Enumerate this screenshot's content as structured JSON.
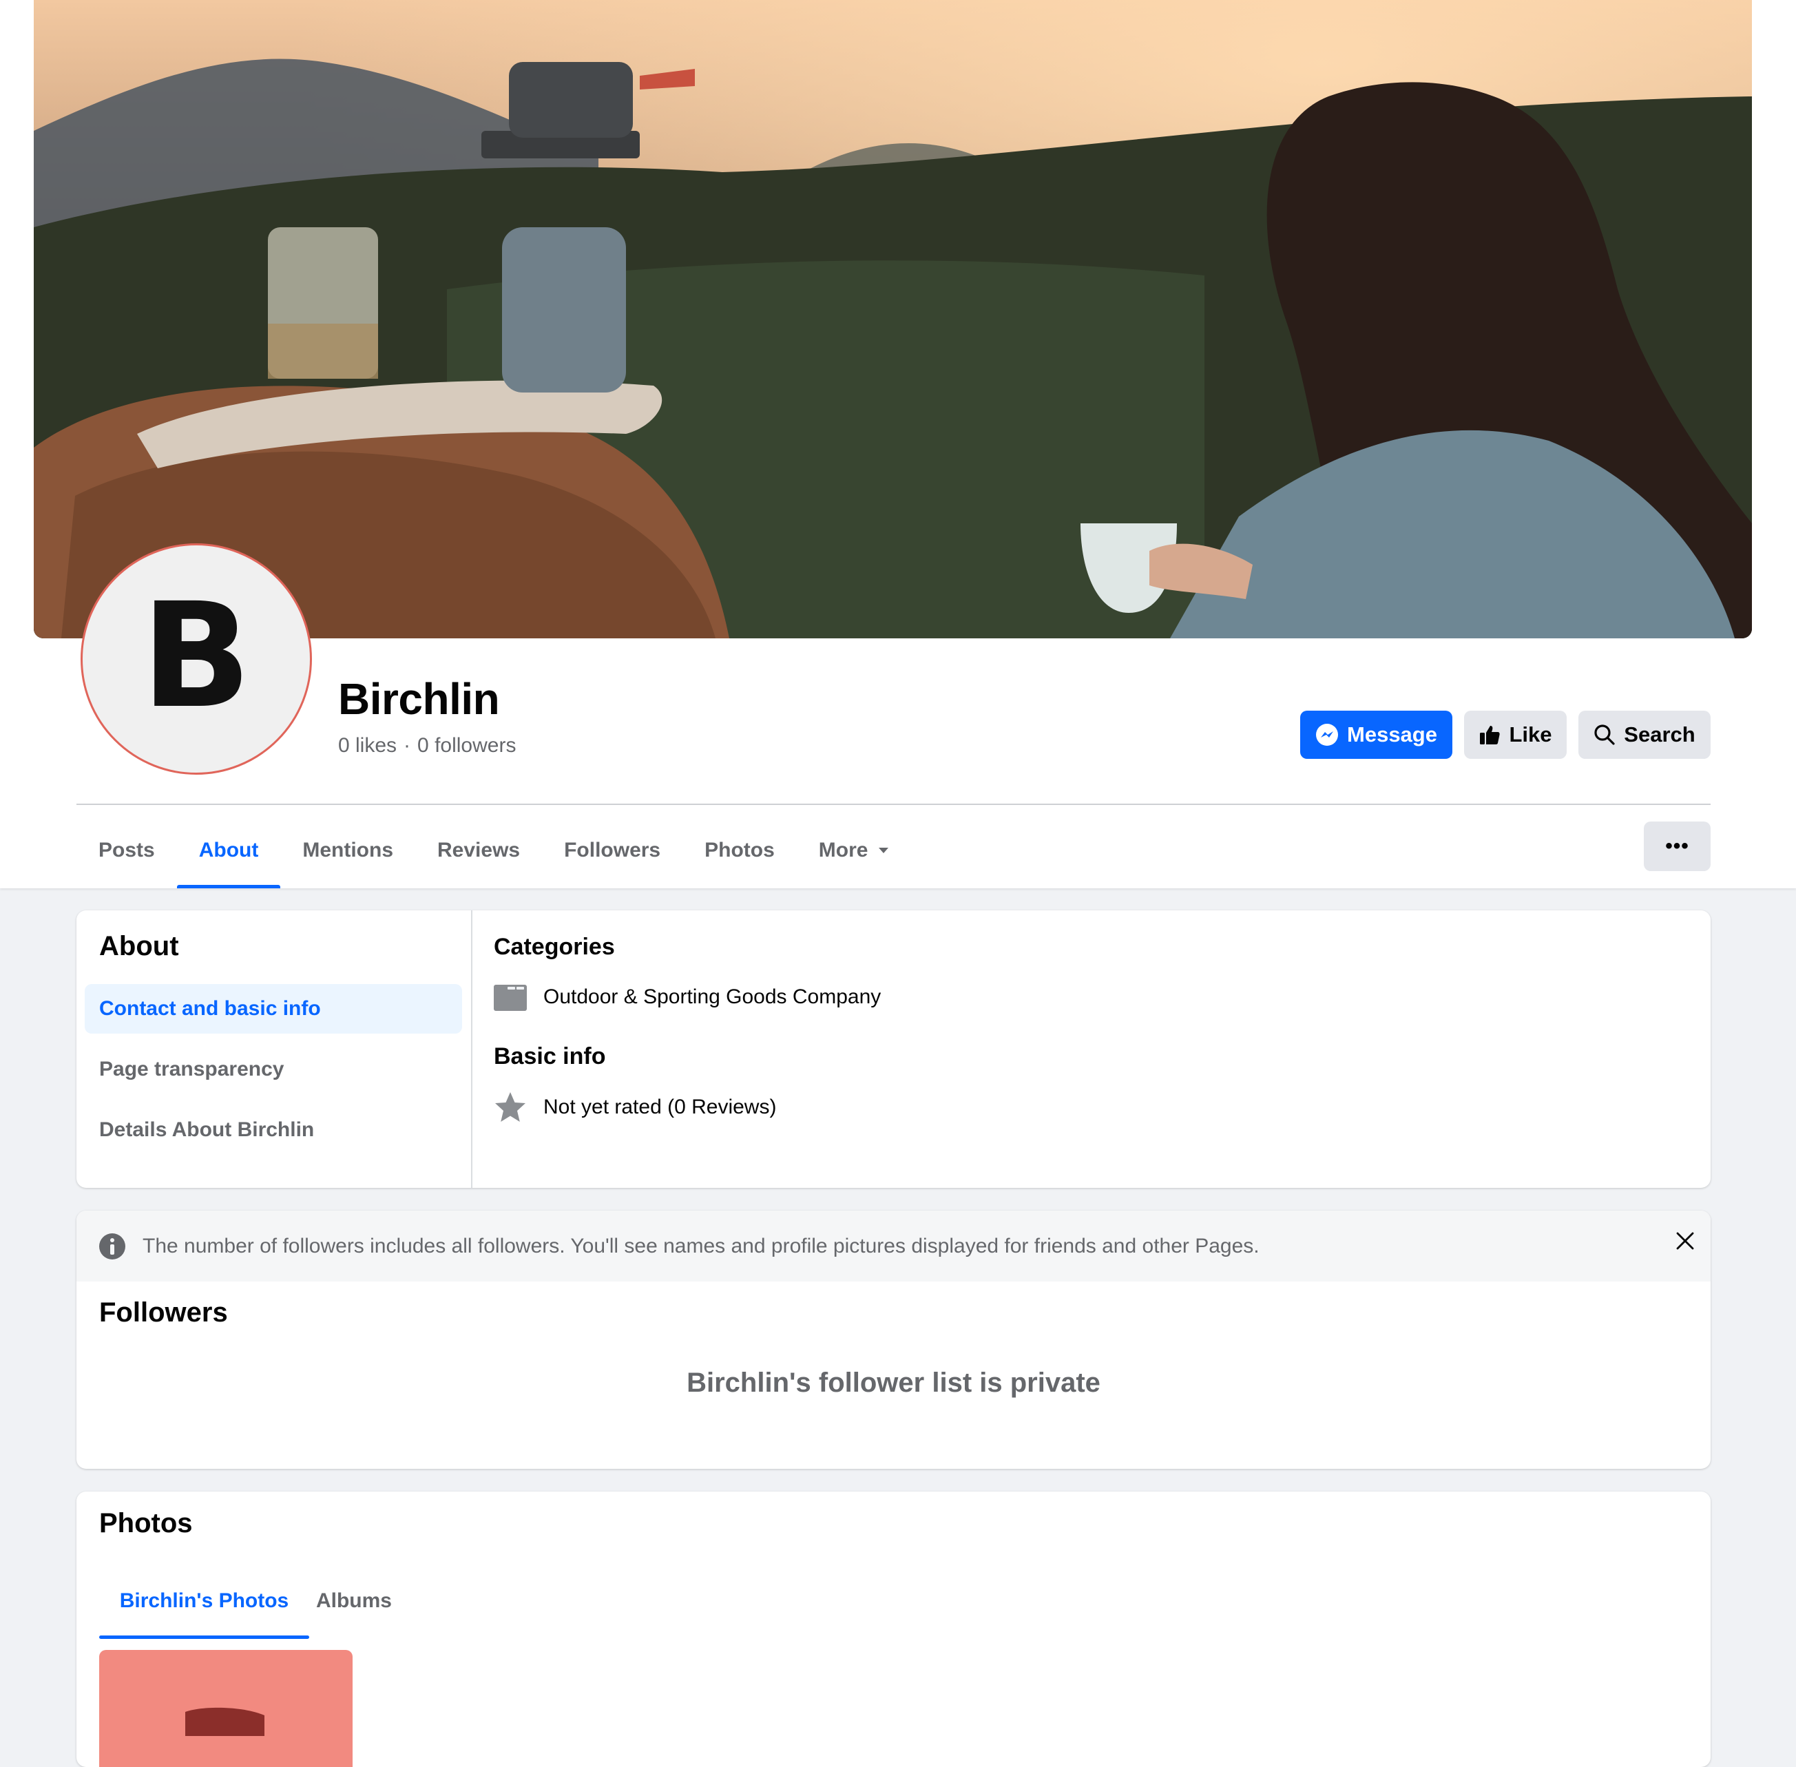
{
  "page": {
    "name": "Birchlin",
    "avatar_letter": "B",
    "likes": "0 likes",
    "separator": "·",
    "followers": "0 followers"
  },
  "actions": {
    "message_label": "Message",
    "like_label": "Like",
    "search_label": "Search"
  },
  "tabs": [
    "Posts",
    "About",
    "Mentions",
    "Reviews",
    "Followers",
    "Photos",
    "More"
  ],
  "active_tab": "About",
  "more_dots": "•••",
  "about": {
    "title": "About",
    "nav": [
      "Contact and basic info",
      "Page transparency",
      "Details About Birchlin"
    ],
    "categories_title": "Categories",
    "category": "Outdoor & Sporting Goods Company",
    "basic_info_title": "Basic info",
    "rating": "Not yet rated (0 Reviews)"
  },
  "followers_section": {
    "notice": "The number of followers includes all followers. You'll see names and profile pictures displayed for friends and other Pages.",
    "title": "Followers",
    "private_message": "Birchlin's follower list is private"
  },
  "photos_section": {
    "title": "Photos",
    "tabs": [
      "Birchlin's Photos",
      "Albums"
    ]
  },
  "colors": {
    "accent": "#0866ff",
    "secondary_text": "#65676b",
    "button_gray": "#e4e6eb",
    "page_bg": "#f0f2f5",
    "avatar_ring": "#e0655a",
    "thumb": "#f28a80"
  }
}
